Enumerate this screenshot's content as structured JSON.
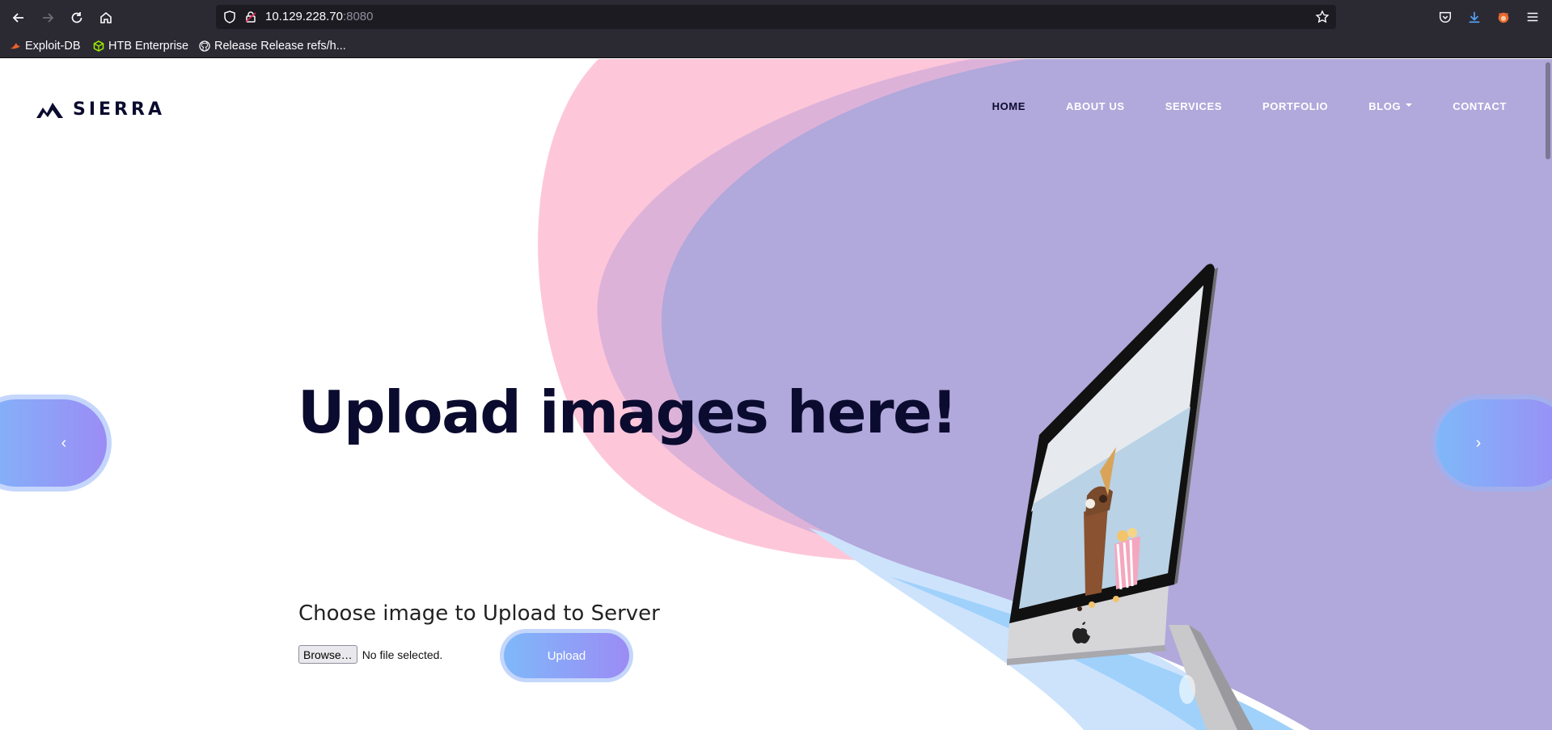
{
  "browser": {
    "url_host": "10.129.228.70",
    "url_port": ":8080",
    "bookmarks": [
      {
        "label": "Exploit-DB",
        "icon": "exploit-db-icon"
      },
      {
        "label": "HTB Enterprise",
        "icon": "htb-cube-icon"
      },
      {
        "label": "Release Release refs/h...",
        "icon": "github-icon"
      }
    ]
  },
  "site": {
    "brand": "SIERRA",
    "nav": [
      {
        "label": "HOME",
        "active": true
      },
      {
        "label": "ABOUT US"
      },
      {
        "label": "SERVICES"
      },
      {
        "label": "PORTFOLIO"
      },
      {
        "label": "BLOG"
      },
      {
        "label": "CONTACT"
      }
    ]
  },
  "hero": {
    "title": "Upload images here!",
    "upload_heading": "Choose image to Upload to Server",
    "browse_label": "Browse…",
    "file_status": "No file selected.",
    "upload_label": "Upload",
    "prev_glyph": "‹",
    "next_glyph": "›"
  },
  "colors": {
    "pink_blob": "#fdc7d9",
    "purple_blob": "#b1a8db",
    "blue_blob": "#9fd1fb",
    "button_gradient_start": "#7fb8f9",
    "button_gradient_end": "#9b8cf5",
    "dark_text": "#0b0b2f"
  }
}
